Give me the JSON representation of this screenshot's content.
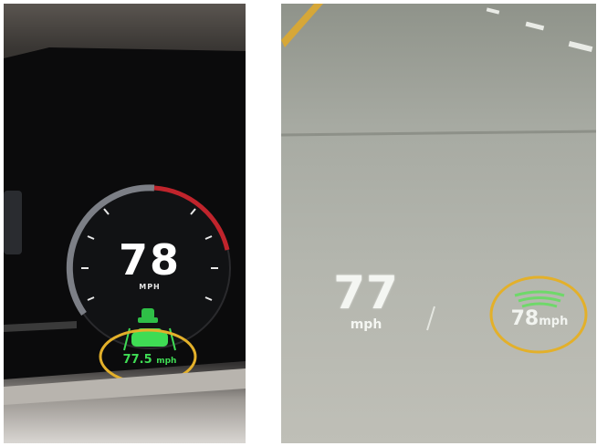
{
  "instrument_cluster": {
    "speed": "78",
    "speed_unit": "MPH",
    "acc_set_speed": "77.5",
    "acc_unit": "mph",
    "highlight_color": "#e3b02a",
    "acc_color": "#3fdc54",
    "gauge_accent_color": "#c0242c"
  },
  "head_up_display": {
    "speed": "77",
    "speed_unit": "mph",
    "acc_set_speed": "78",
    "acc_unit": "mph",
    "highlight_color": "#e3b02a",
    "acc_color": "#6fd86a"
  }
}
